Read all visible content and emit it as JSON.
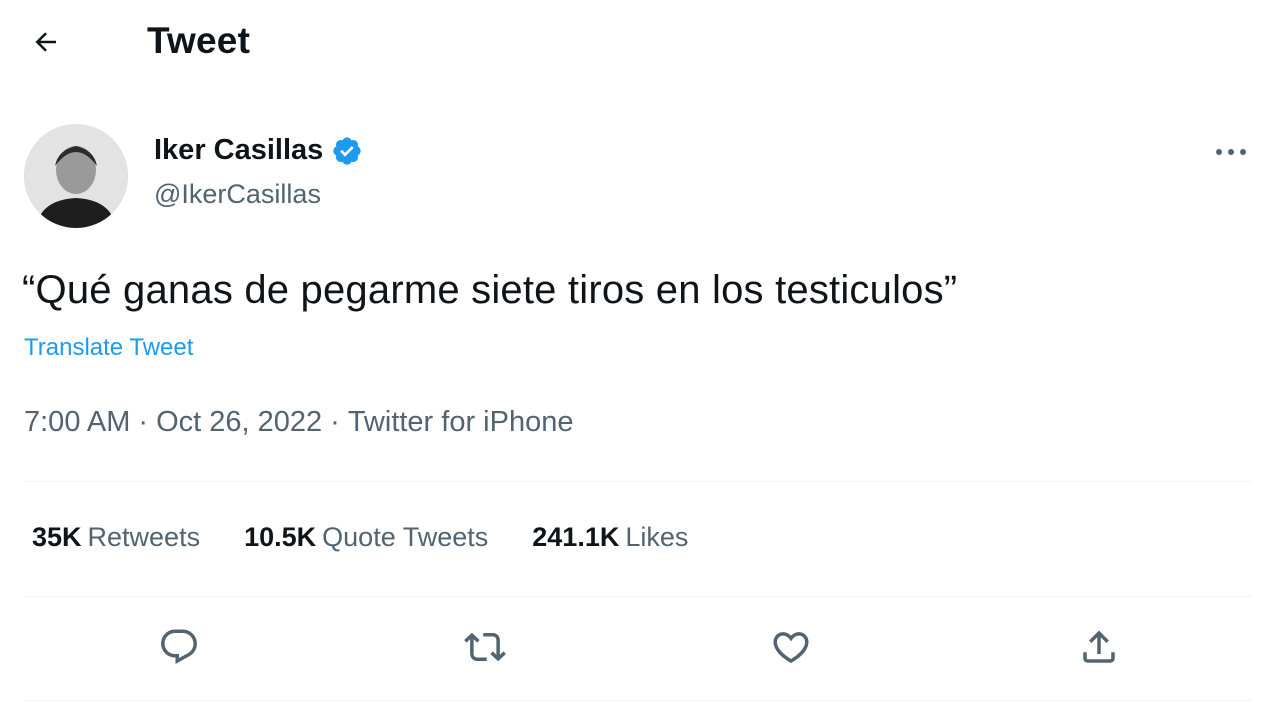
{
  "header": {
    "title": "Tweet",
    "back_icon": "arrow-left-icon"
  },
  "author": {
    "name": "Iker Casillas",
    "handle": "@IkerCasillas",
    "verified": true,
    "verified_color": "#1d9bf0"
  },
  "tweet": {
    "text": "“Qué ganas de pegarme siete tiros en los testiculos”",
    "translate_label": "Translate Tweet",
    "time": "7:00 AM",
    "date": "Oct 26, 2022",
    "source": "Twitter for iPhone",
    "separator": "·"
  },
  "stats": {
    "retweets": {
      "count": "35K",
      "label": "Retweets"
    },
    "quotes": {
      "count": "10.5K",
      "label": "Quote Tweets"
    },
    "likes": {
      "count": "241.1K",
      "label": "Likes"
    }
  },
  "actions": [
    "reply-icon",
    "retweet-icon",
    "like-icon",
    "share-icon"
  ],
  "colors": {
    "accent": "#1d9bf0",
    "text": "#0f1419",
    "secondary": "#536471"
  }
}
